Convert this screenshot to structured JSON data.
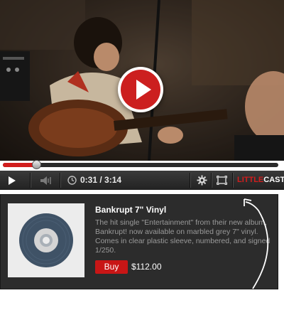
{
  "player": {
    "time_display": "0:31 / 3:14",
    "progress_fraction": 0.12,
    "brand_part1": "LITTLE",
    "brand_part2": "CAST",
    "accent_color": "#d11d1d",
    "icons": [
      "play-icon",
      "volume-icon",
      "clock-icon",
      "gear-icon",
      "fullscreen-icon"
    ]
  },
  "product": {
    "title": "Bankrupt 7\" Vinyl",
    "description": "The hit single \"Entertainment\" from their new album, Bankrupt! now available on marbled grey 7\" vinyl. Comes in clear plastic sleeve, numbered, and signed 1/250.",
    "buy_label": "Buy",
    "price": "$112.00"
  }
}
